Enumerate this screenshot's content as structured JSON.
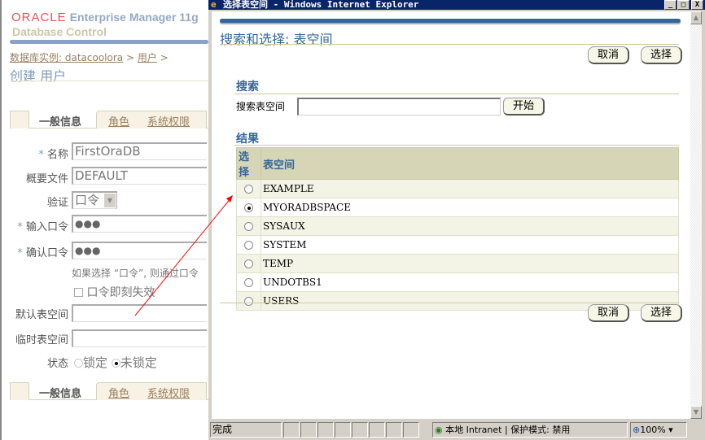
{
  "background_page": {
    "logo_brand": "ORACLE",
    "logo_product": "Enterprise Manager 11g",
    "logo_subtitle": "Database Control",
    "breadcrumb": {
      "instance_link": "数据库实例: datacoolora",
      "sep1": ">",
      "users_link": "用户",
      "sep2": ">"
    },
    "page_title": "创建  用户",
    "tabs": [
      "一般信息",
      "角色",
      "系统权限"
    ],
    "form": {
      "name_label": "名称",
      "name_value": "FirstOraDB",
      "profile_label": "概要文件",
      "profile_value": "DEFAULT",
      "auth_label": "验证",
      "auth_value": "口令",
      "password_label": "输入口令",
      "password_value": "●●●",
      "confirm_label": "确认口令",
      "confirm_value": "●●●",
      "hint": "如果选择 “口令”, 则通过口令",
      "expire_label": "口令即刻失效",
      "default_ts_label": "默认表空间",
      "default_ts_value": "",
      "temp_ts_label": "临时表空间",
      "temp_ts_value": "",
      "status_label": "状态",
      "status_locked": "锁定",
      "status_unlocked": "未锁定"
    }
  },
  "popup": {
    "window_title": "选择表空间 - Windows Internet Explorer",
    "title": "搜索和选择: 表空间",
    "cancel_label": "取消",
    "select_label": "选择",
    "search_heading": "搜索",
    "search_label": "搜索表空间",
    "search_value": "",
    "go_label": "开始",
    "results_heading": "结果",
    "columns": [
      "选择",
      "表空间"
    ],
    "rows": [
      {
        "name": "EXAMPLE",
        "selected": false
      },
      {
        "name": "MYORADBSPACE",
        "selected": true
      },
      {
        "name": "SYSAUX",
        "selected": false
      },
      {
        "name": "SYSTEM",
        "selected": false
      },
      {
        "name": "TEMP",
        "selected": false
      },
      {
        "name": "UNDOTBS1",
        "selected": false
      },
      {
        "name": "USERS",
        "selected": false
      }
    ],
    "status_bar": {
      "text": "完成",
      "zone": "本地 Intranet | 保护模式: 禁用",
      "zoom": "100%"
    }
  },
  "colors": {
    "accent": "#336699",
    "annotation": "#ff0000"
  }
}
